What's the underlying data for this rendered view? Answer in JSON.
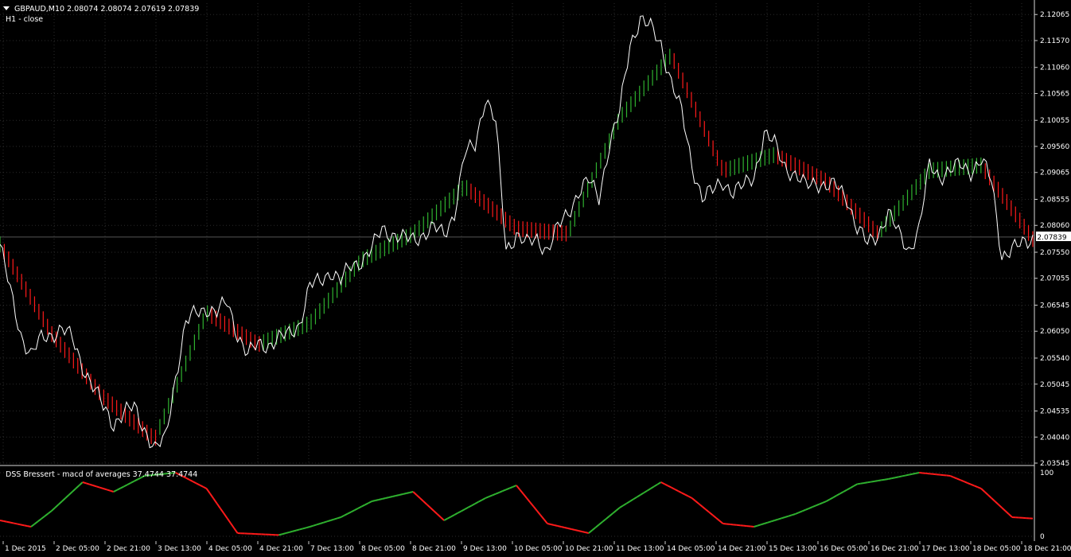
{
  "header": {
    "symbol_line": "GBPAUD,M10  2.08074 2.08074 2.07619 2.07839",
    "subtitle": "H1 - close"
  },
  "indicator": {
    "title": "DSS Bressert - macd of averages 37.4744 37.4744",
    "levels": [
      "100",
      "0"
    ]
  },
  "colors": {
    "background": "#000000",
    "axis_text": "#ffffff",
    "grid": "#2b2b2b",
    "up": "#2fb12f",
    "down": "#ff1a1a",
    "close_line": "#ffffff",
    "price_badge_bg": "#ffffff",
    "price_badge_text": "#000000"
  },
  "price_axis": {
    "ticks": [
      "2.12065",
      "2.11570",
      "2.11060",
      "2.10565",
      "2.10055",
      "2.09560",
      "2.09065",
      "2.08555",
      "2.08060",
      "2.07550",
      "2.07055",
      "2.06545",
      "2.06050",
      "2.05540",
      "2.05045",
      "2.04535",
      "2.04040",
      "2.03545"
    ],
    "current_price": "2.07839",
    "range": [
      2.0353,
      2.1228
    ]
  },
  "time_axis": {
    "labels": [
      "1 Dec 2015",
      "2 Dec 05:00",
      "2 Dec 21:00",
      "3 Dec 13:00",
      "4 Dec 05:00",
      "4 Dec 21:00",
      "7 Dec 13:00",
      "8 Dec 05:00",
      "8 Dec 21:00",
      "9 Dec 13:00",
      "10 Dec 05:00",
      "10 Dec 21:00",
      "11 Dec 13:00",
      "14 Dec 05:00",
      "14 Dec 21:00",
      "15 Dec 13:00",
      "16 Dec 05:00",
      "16 Dec 21:00",
      "17 Dec 13:00",
      "18 Dec 05:00",
      "18 Dec 21:00"
    ]
  },
  "chart_data": [
    {
      "type": "line",
      "name": "H1 - close",
      "ylim": [
        2.0353,
        2.1228
      ],
      "x": [
        0,
        0.01,
        0.02,
        0.03,
        0.04,
        0.05,
        0.06,
        0.07,
        0.08,
        0.09,
        0.1,
        0.11,
        0.12,
        0.13,
        0.14,
        0.15,
        0.16,
        0.17,
        0.18,
        0.19,
        0.2,
        0.21,
        0.22,
        0.23,
        0.24,
        0.25,
        0.26,
        0.27,
        0.28,
        0.29,
        0.3,
        0.31,
        0.32,
        0.33,
        0.34,
        0.35,
        0.36,
        0.37,
        0.38,
        0.39,
        0.4,
        0.41,
        0.42,
        0.43,
        0.44,
        0.45,
        0.46,
        0.47,
        0.48,
        0.49,
        0.5,
        0.51,
        0.52,
        0.53,
        0.54,
        0.55,
        0.56,
        0.57,
        0.58,
        0.59,
        0.6,
        0.61,
        0.62,
        0.63,
        0.64,
        0.65,
        0.66,
        0.67,
        0.68,
        0.69,
        0.7,
        0.71,
        0.72,
        0.73,
        0.74,
        0.75,
        0.76,
        0.77,
        0.78,
        0.79,
        0.8,
        0.81,
        0.82,
        0.83,
        0.84,
        0.85,
        0.86,
        0.87,
        0.88,
        0.89,
        0.9,
        0.91,
        0.92,
        0.93,
        0.94,
        0.95,
        0.96,
        0.97,
        0.98,
        0.99,
        1.0
      ],
      "values": [
        2.077,
        2.068,
        2.06,
        2.056,
        2.059,
        2.06,
        2.061,
        2.059,
        2.054,
        2.05,
        2.046,
        2.043,
        2.045,
        2.046,
        2.042,
        2.038,
        2.04,
        2.052,
        2.062,
        2.064,
        2.065,
        2.064,
        2.066,
        2.06,
        2.056,
        2.058,
        2.058,
        2.059,
        2.06,
        2.062,
        2.069,
        2.07,
        2.072,
        2.07,
        2.073,
        2.074,
        2.076,
        2.08,
        2.079,
        2.078,
        2.078,
        2.079,
        2.08,
        2.079,
        2.083,
        2.094,
        2.096,
        2.105,
        2.1,
        2.076,
        2.079,
        2.077,
        2.078,
        2.076,
        2.08,
        2.083,
        2.087,
        2.089,
        2.086,
        2.096,
        2.102,
        2.115,
        2.12,
        2.118,
        2.115,
        2.108,
        2.102,
        2.092,
        2.086,
        2.087,
        2.089,
        2.087,
        2.088,
        2.09,
        2.098,
        2.096,
        2.092,
        2.09,
        2.088,
        2.089,
        2.088,
        2.088,
        2.086,
        2.08,
        2.077,
        2.079,
        2.083,
        2.079,
        2.076,
        2.08,
        2.092,
        2.09,
        2.091,
        2.092,
        2.091,
        2.093,
        2.089,
        2.075,
        2.076,
        2.077,
        2.0784
      ]
    },
    {
      "type": "bar",
      "name": "colored bars",
      "ylim": [
        2.0353,
        2.1228
      ],
      "x": [
        0,
        0.05,
        0.1,
        0.15,
        0.2,
        0.25,
        0.3,
        0.35,
        0.4,
        0.45,
        0.5,
        0.55,
        0.6,
        0.65,
        0.7,
        0.75,
        0.8,
        0.85,
        0.9,
        0.95,
        1.0
      ],
      "values": [
        2.077,
        2.06,
        2.048,
        2.04,
        2.064,
        2.058,
        2.062,
        2.074,
        2.079,
        2.088,
        2.08,
        2.079,
        2.101,
        2.113,
        2.091,
        2.094,
        2.089,
        2.079,
        2.091,
        2.092,
        2.078
      ]
    },
    {
      "type": "line",
      "name": "DSS Bressert - macd of averages",
      "ylim": [
        0,
        100
      ],
      "x": [
        0,
        0.03,
        0.05,
        0.08,
        0.11,
        0.14,
        0.17,
        0.2,
        0.23,
        0.27,
        0.3,
        0.33,
        0.36,
        0.4,
        0.43,
        0.47,
        0.5,
        0.53,
        0.57,
        0.6,
        0.64,
        0.67,
        0.7,
        0.73,
        0.77,
        0.8,
        0.83,
        0.86,
        0.89,
        0.92,
        0.95,
        0.98,
        1.0
      ],
      "values": [
        25,
        15,
        40,
        85,
        70,
        95,
        100,
        75,
        5,
        2,
        15,
        30,
        55,
        70,
        25,
        60,
        80,
        20,
        5,
        45,
        85,
        60,
        20,
        15,
        35,
        55,
        82,
        90,
        100,
        95,
        75,
        30,
        28
      ]
    }
  ]
}
